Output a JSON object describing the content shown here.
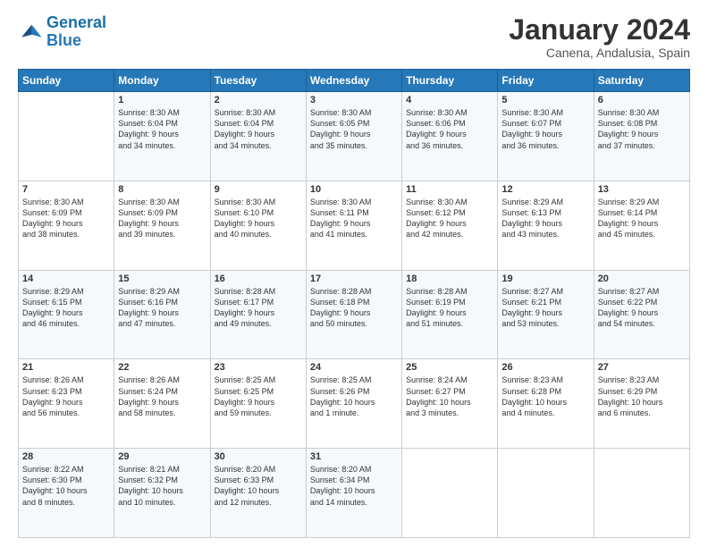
{
  "logo": {
    "line1": "General",
    "line2": "Blue"
  },
  "header": {
    "month": "January 2024",
    "location": "Canena, Andalusia, Spain"
  },
  "weekdays": [
    "Sunday",
    "Monday",
    "Tuesday",
    "Wednesday",
    "Thursday",
    "Friday",
    "Saturday"
  ],
  "weeks": [
    [
      {
        "day": "",
        "content": ""
      },
      {
        "day": "1",
        "content": "Sunrise: 8:30 AM\nSunset: 6:04 PM\nDaylight: 9 hours\nand 34 minutes."
      },
      {
        "day": "2",
        "content": "Sunrise: 8:30 AM\nSunset: 6:04 PM\nDaylight: 9 hours\nand 34 minutes."
      },
      {
        "day": "3",
        "content": "Sunrise: 8:30 AM\nSunset: 6:05 PM\nDaylight: 9 hours\nand 35 minutes."
      },
      {
        "day": "4",
        "content": "Sunrise: 8:30 AM\nSunset: 6:06 PM\nDaylight: 9 hours\nand 36 minutes."
      },
      {
        "day": "5",
        "content": "Sunrise: 8:30 AM\nSunset: 6:07 PM\nDaylight: 9 hours\nand 36 minutes."
      },
      {
        "day": "6",
        "content": "Sunrise: 8:30 AM\nSunset: 6:08 PM\nDaylight: 9 hours\nand 37 minutes."
      }
    ],
    [
      {
        "day": "7",
        "content": "Sunrise: 8:30 AM\nSunset: 6:09 PM\nDaylight: 9 hours\nand 38 minutes."
      },
      {
        "day": "8",
        "content": "Sunrise: 8:30 AM\nSunset: 6:09 PM\nDaylight: 9 hours\nand 39 minutes."
      },
      {
        "day": "9",
        "content": "Sunrise: 8:30 AM\nSunset: 6:10 PM\nDaylight: 9 hours\nand 40 minutes."
      },
      {
        "day": "10",
        "content": "Sunrise: 8:30 AM\nSunset: 6:11 PM\nDaylight: 9 hours\nand 41 minutes."
      },
      {
        "day": "11",
        "content": "Sunrise: 8:30 AM\nSunset: 6:12 PM\nDaylight: 9 hours\nand 42 minutes."
      },
      {
        "day": "12",
        "content": "Sunrise: 8:29 AM\nSunset: 6:13 PM\nDaylight: 9 hours\nand 43 minutes."
      },
      {
        "day": "13",
        "content": "Sunrise: 8:29 AM\nSunset: 6:14 PM\nDaylight: 9 hours\nand 45 minutes."
      }
    ],
    [
      {
        "day": "14",
        "content": "Sunrise: 8:29 AM\nSunset: 6:15 PM\nDaylight: 9 hours\nand 46 minutes."
      },
      {
        "day": "15",
        "content": "Sunrise: 8:29 AM\nSunset: 6:16 PM\nDaylight: 9 hours\nand 47 minutes."
      },
      {
        "day": "16",
        "content": "Sunrise: 8:28 AM\nSunset: 6:17 PM\nDaylight: 9 hours\nand 49 minutes."
      },
      {
        "day": "17",
        "content": "Sunrise: 8:28 AM\nSunset: 6:18 PM\nDaylight: 9 hours\nand 50 minutes."
      },
      {
        "day": "18",
        "content": "Sunrise: 8:28 AM\nSunset: 6:19 PM\nDaylight: 9 hours\nand 51 minutes."
      },
      {
        "day": "19",
        "content": "Sunrise: 8:27 AM\nSunset: 6:21 PM\nDaylight: 9 hours\nand 53 minutes."
      },
      {
        "day": "20",
        "content": "Sunrise: 8:27 AM\nSunset: 6:22 PM\nDaylight: 9 hours\nand 54 minutes."
      }
    ],
    [
      {
        "day": "21",
        "content": "Sunrise: 8:26 AM\nSunset: 6:23 PM\nDaylight: 9 hours\nand 56 minutes."
      },
      {
        "day": "22",
        "content": "Sunrise: 8:26 AM\nSunset: 6:24 PM\nDaylight: 9 hours\nand 58 minutes."
      },
      {
        "day": "23",
        "content": "Sunrise: 8:25 AM\nSunset: 6:25 PM\nDaylight: 9 hours\nand 59 minutes."
      },
      {
        "day": "24",
        "content": "Sunrise: 8:25 AM\nSunset: 6:26 PM\nDaylight: 10 hours\nand 1 minute."
      },
      {
        "day": "25",
        "content": "Sunrise: 8:24 AM\nSunset: 6:27 PM\nDaylight: 10 hours\nand 3 minutes."
      },
      {
        "day": "26",
        "content": "Sunrise: 8:23 AM\nSunset: 6:28 PM\nDaylight: 10 hours\nand 4 minutes."
      },
      {
        "day": "27",
        "content": "Sunrise: 8:23 AM\nSunset: 6:29 PM\nDaylight: 10 hours\nand 6 minutes."
      }
    ],
    [
      {
        "day": "28",
        "content": "Sunrise: 8:22 AM\nSunset: 6:30 PM\nDaylight: 10 hours\nand 8 minutes."
      },
      {
        "day": "29",
        "content": "Sunrise: 8:21 AM\nSunset: 6:32 PM\nDaylight: 10 hours\nand 10 minutes."
      },
      {
        "day": "30",
        "content": "Sunrise: 8:20 AM\nSunset: 6:33 PM\nDaylight: 10 hours\nand 12 minutes."
      },
      {
        "day": "31",
        "content": "Sunrise: 8:20 AM\nSunset: 6:34 PM\nDaylight: 10 hours\nand 14 minutes."
      },
      {
        "day": "",
        "content": ""
      },
      {
        "day": "",
        "content": ""
      },
      {
        "day": "",
        "content": ""
      }
    ]
  ]
}
